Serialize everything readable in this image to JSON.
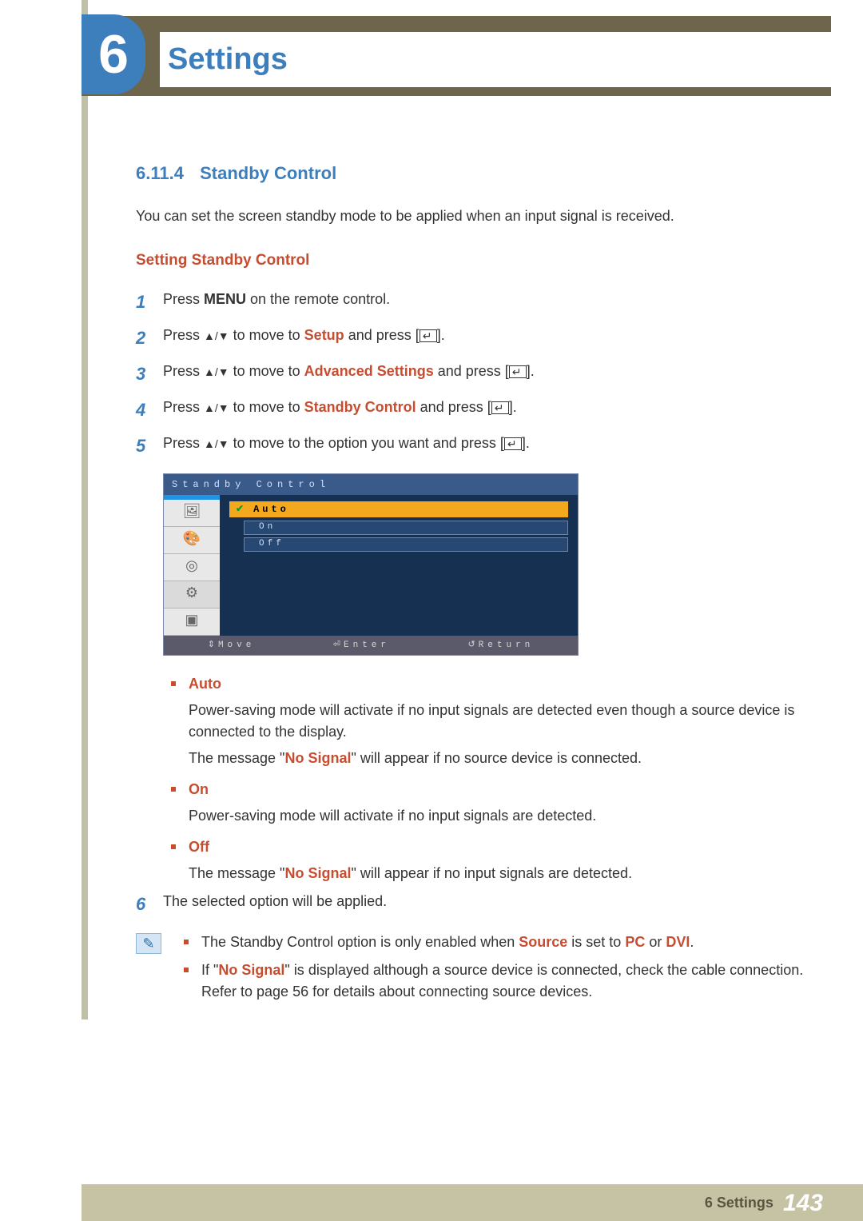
{
  "chapter": {
    "number": "6",
    "title": "Settings"
  },
  "section": {
    "number": "6.11.4",
    "title": "Standby Control"
  },
  "intro": "You can set the screen standby mode to be applied when an input signal is received.",
  "sub_heading": "Setting Standby Control",
  "steps": {
    "s1": {
      "num": "1",
      "pre": "Press ",
      "key": "MENU",
      "post": " on the remote control."
    },
    "s2": {
      "num": "2",
      "pre": "Press ",
      "arrows": "▲/▼",
      "mid": " to move to ",
      "target": "Setup",
      "andpress": " and press [",
      "close": "]."
    },
    "s3": {
      "num": "3",
      "pre": "Press ",
      "arrows": "▲/▼",
      "mid": " to move to ",
      "target": "Advanced Settings",
      "andpress": " and press [",
      "close": "]."
    },
    "s4": {
      "num": "4",
      "pre": "Press ",
      "arrows": "▲/▼",
      "mid": " to move to ",
      "target": "Standby Control",
      "andpress": " and press [",
      "close": "]."
    },
    "s5": {
      "num": "5",
      "pre": "Press ",
      "arrows": "▲/▼",
      "mid": " to move to the option you want and press [",
      "close": "]."
    },
    "s6": {
      "num": "6",
      "text": "The selected option will be applied."
    }
  },
  "osd": {
    "title": "Standby Control",
    "selected": "Auto",
    "options": [
      "On",
      "Off"
    ],
    "footer": {
      "move": "Move",
      "enter": "Enter",
      "return": "Return"
    }
  },
  "options": {
    "auto": {
      "title": "Auto",
      "desc1_a": "Power-saving mode will activate if no input signals are detected even though a source device is connected to the display.",
      "desc2_a": "The message \"",
      "desc2_b": "No Signal",
      "desc2_c": "\" will appear if no source device is connected."
    },
    "on": {
      "title": "On",
      "desc": "Power-saving mode will activate if no input signals are detected."
    },
    "off": {
      "title": "Off",
      "desc_a": "The message \"",
      "desc_b": "No Signal",
      "desc_c": "\" will appear if no input signals are detected."
    }
  },
  "notes": {
    "n1_a": "The Standby Control option is only enabled when ",
    "n1_source": "Source",
    "n1_b": " is set to ",
    "n1_pc": "PC",
    "n1_or": " or ",
    "n1_dvi": "DVI",
    "n1_end": ".",
    "n2_a": "If \"",
    "n2_b": "No Signal",
    "n2_c": "\" is displayed although a source device is connected, check the cable connection. Refer to page 56 for details about connecting source devices."
  },
  "footer": {
    "label": "6 Settings",
    "page": "143"
  }
}
